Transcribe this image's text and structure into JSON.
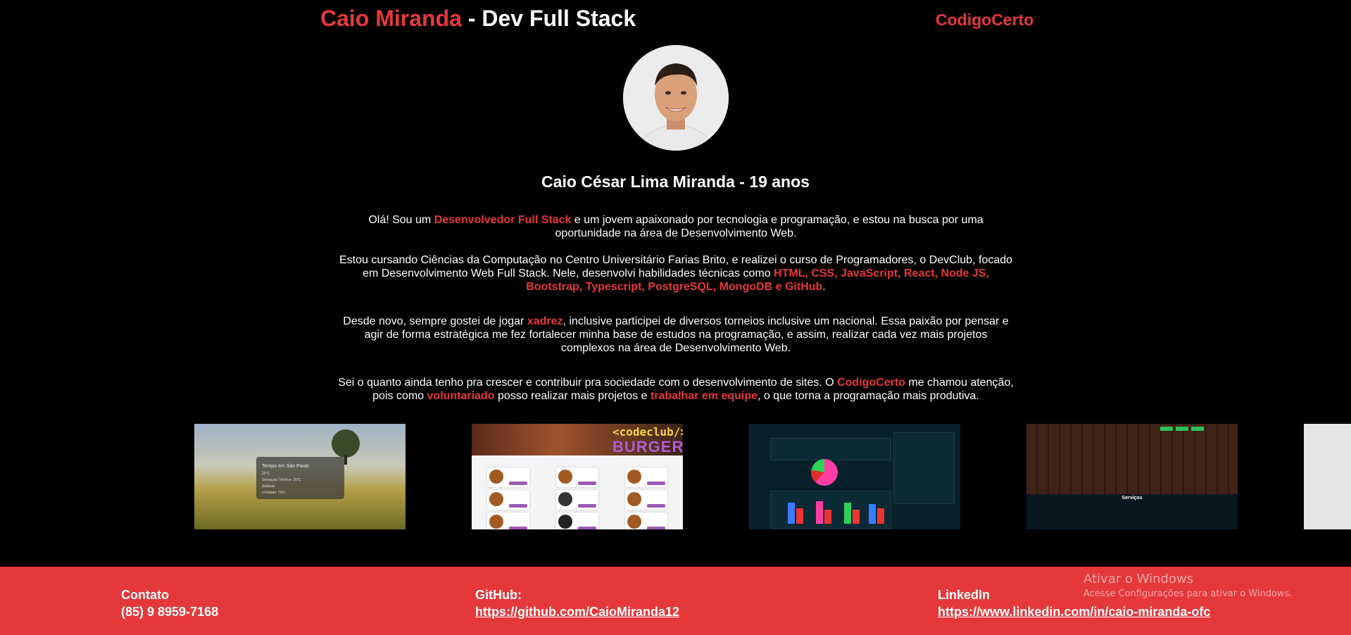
{
  "header": {
    "name_highlight": "Caio Miranda",
    "name_rest": " - Dev Full Stack",
    "brand_link": "CodigoCerto"
  },
  "profile": {
    "title": "Caio César Lima Miranda - 19 anos"
  },
  "about": {
    "p1": {
      "a": "Olá! Sou um ",
      "hl": "Desenvolvedor Full Stack",
      "b": " e um jovem apaixonado por tecnologia e programação, e estou na busca por uma oportunidade na área de Desenvolvimento Web."
    },
    "p2": {
      "a": "Estou cursando Ciências da Computação no Centro Universitário Farias Brito, e realizei o curso de Programadores, o DevClub, focado em Desenvolvimento Web Full Stack. Nele, desenvolvi habilidades técnicas como ",
      "hl": "HTML, CSS, JavaScript, React, Node JS, Bootstrap, Typescript, PostgreSQL, MongoDB e GitHub",
      "b": "."
    },
    "p3": {
      "a": "Desde novo, sempre gostei de jogar ",
      "hl": "xadrez",
      "b": ", inclusive participei de diversos torneios inclusive um nacional. Essa paixão por pensar e agir de forma estratégica me fez fortalecer minha base de estudos na programação, e assim, realizar cada vez mais projetos complexos na área de Desenvolvimento Web."
    },
    "p4": {
      "a": "Sei o quanto ainda tenho pra crescer e contribuir pra sociedade com o desenvolvimento de sites. O ",
      "hl1": "CodigoCerto",
      "b": " me chamou atenção, pois como ",
      "hl2": "voluntariado",
      "c": " posso realizar mais projetos e ",
      "hl3": "trabalhar em equipe",
      "d": ", o que torna a programação mais produtiva."
    }
  },
  "projects": {
    "weather": {
      "line1": "Tempo em São Paulo",
      "line2": "22°C",
      "line3": "Sensação Térmica: 20°C",
      "line4": "Nublado",
      "line5": "Umidade: 70%"
    },
    "burger": {
      "logo_top": "<codeclub/>",
      "logo_bottom": "BURGER"
    },
    "barber": {
      "section": "Serviços"
    }
  },
  "footer": {
    "contact_label": "Contato",
    "contact_value": "(85) 9 8959-7168",
    "github_label": "GitHub:",
    "github_url": "https://github.com/CaioMiranda12",
    "linkedin_label": "LinkedIn",
    "linkedin_url": "https://www.linkedin.com/in/caio-miranda-ofc"
  },
  "watermark": {
    "title": "Ativar o Windows",
    "subtitle": "Acesse Configurações para ativar o Windows."
  }
}
